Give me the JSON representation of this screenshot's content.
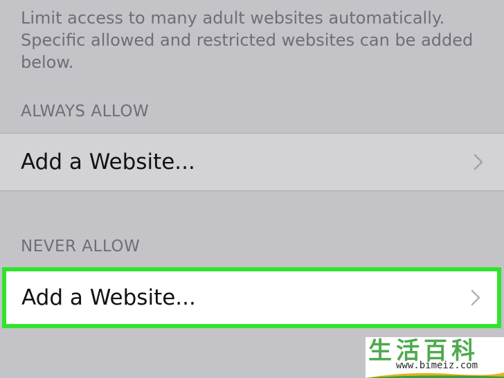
{
  "description": "Limit access to many adult websites automatically.\nSpecific allowed and restricted websites can be added\nbelow.",
  "sections": {
    "always_allow": {
      "header": "ALWAYS ALLOW",
      "row_label": "Add a Website..."
    },
    "never_allow": {
      "header": "NEVER ALLOW",
      "row_label": "Add a Website..."
    }
  },
  "watermark": {
    "chars": "生活百科",
    "url": "www.bimeiz.com"
  },
  "colors": {
    "background": "#c4c3c8",
    "highlight_border": "#2fe42c",
    "secondary_text": "#6f6e74"
  },
  "icons": {
    "row_disclosure": "chevron-right-icon"
  }
}
